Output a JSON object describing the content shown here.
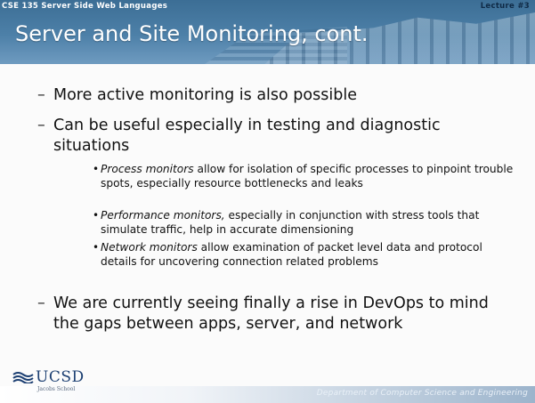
{
  "header": {
    "course": "CSE 135 Server Side Web Languages",
    "lecture": "Lecture #3",
    "title": "Server and Site Monitoring, cont."
  },
  "bullets": [
    {
      "text": "More active monitoring is also possible"
    },
    {
      "text": "Can be useful especially in testing and diagnostic situations"
    }
  ],
  "subbullets": [
    {
      "term": "Process monitors",
      "text": " allow for isolation of specific processes to pinpoint trouble spots, especially resource bottlenecks and leaks"
    },
    {
      "term": "Performance monitors,",
      "text": " especially in conjunction with stress tools that simulate traffic, help in accurate dimensioning"
    },
    {
      "term": "Network monitors",
      "text": " allow examination of packet level data and protocol details for uncovering connection related problems"
    }
  ],
  "final_bullet": {
    "text": "We are currently seeing finally a rise in DevOps to mind the gaps between apps, server, and network"
  },
  "footer": {
    "logo": "UCSD",
    "logo_sub": "Jacobs School",
    "department": "Department of Computer Science and Engineering"
  },
  "colors": {
    "header": "#4d80a8",
    "title_text": "#ffffff",
    "logo": "#1c3f72"
  }
}
